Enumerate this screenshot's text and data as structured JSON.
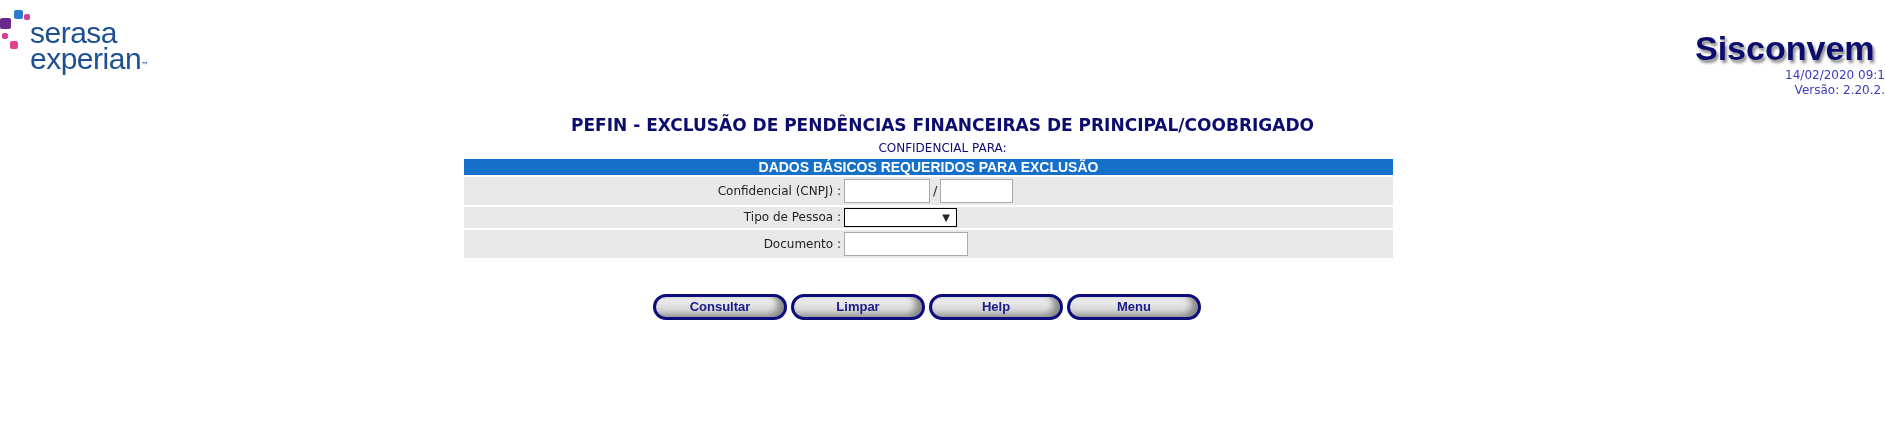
{
  "logo": {
    "line1": "serasa",
    "line2": "experian",
    "mark": "™"
  },
  "brand": {
    "title": "Sisconvem",
    "datetime": "14/02/2020 09:1",
    "version": "Versão: 2.20.2."
  },
  "page_title": "PEFIN - EXCLUSÃO DE PENDÊNCIAS FINANCEIRAS DE PRINCIPAL/COOBRIGADO",
  "subtitle": "CONFIDENCIAL PARA:",
  "form": {
    "header": "DADOS BÁSICOS REQUERIDOS PARA EXCLUSÃO",
    "rows": [
      {
        "kind": "pair",
        "label": "Confidencial (CNPJ) :",
        "separator": "/"
      },
      {
        "kind": "select",
        "label": "Tipo de Pessoa :",
        "arrow": "▼"
      },
      {
        "kind": "text",
        "label": "Documento :"
      }
    ]
  },
  "buttons": [
    "Consultar",
    "Limpar",
    "Help",
    "Menu"
  ]
}
